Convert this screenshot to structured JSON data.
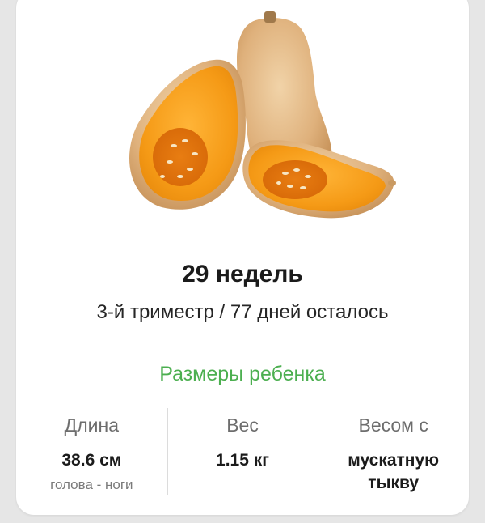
{
  "week_title": "29 недель",
  "subtitle": "3-й триместр / 77 дней осталось",
  "section_heading": "Размеры ребенка",
  "stats": [
    {
      "label": "Длина",
      "value": "38.6 см",
      "note": "голова - ноги"
    },
    {
      "label": "Вес",
      "value": "1.15 кг",
      "note": ""
    },
    {
      "label": "Весом с",
      "value": "мускатную\nтыкву",
      "note": ""
    }
  ],
  "colors": {
    "accent_green": "#4caf50",
    "pumpkin_flesh": "#f49a1a",
    "pumpkin_skin": "#e2b886"
  },
  "image": {
    "icon": "butternut-squash-illustration"
  }
}
